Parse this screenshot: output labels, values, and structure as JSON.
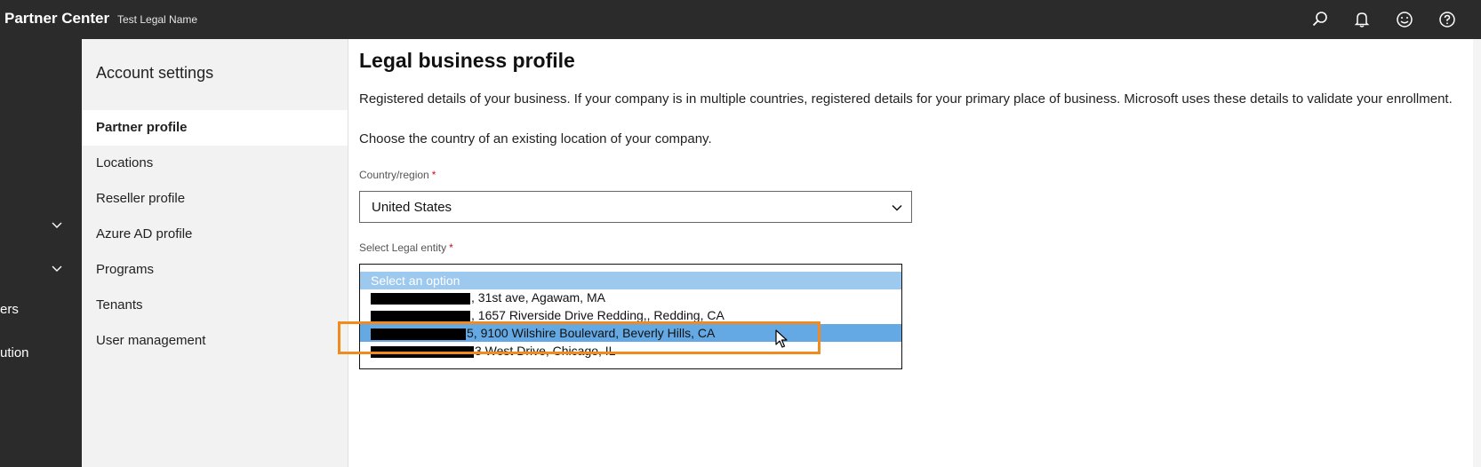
{
  "topbar": {
    "app_title": "Partner Center",
    "tenant_name": "Test Legal Name",
    "icons": [
      "search-icon",
      "notification-bell-icon",
      "feedback-smiley-icon",
      "help-icon"
    ]
  },
  "left_nav": {
    "items_visible_text": [
      "ers",
      "ution"
    ],
    "chevrons": [
      "chevron-down-icon",
      "chevron-down-icon"
    ]
  },
  "settings": {
    "title": "Account settings",
    "items": [
      {
        "label": "Partner profile",
        "active": true
      },
      {
        "label": "Locations"
      },
      {
        "label": "Reseller profile"
      },
      {
        "label": "Azure AD profile"
      },
      {
        "label": "Programs"
      },
      {
        "label": "Tenants"
      },
      {
        "label": "User management"
      }
    ]
  },
  "main": {
    "title": "Legal business profile",
    "description": "Registered details of your business. If your company is in multiple countries, registered details for your primary place of business. Microsoft uses these details to validate your enrollment.",
    "choose_text": "Choose the country of an existing location of your company.",
    "country": {
      "label": "Country/region",
      "required_mark": "*",
      "value": "United States"
    },
    "entity": {
      "label": "Select Legal entity",
      "required_mark": "*",
      "options": [
        {
          "text": "Select an option",
          "state": "placeholder"
        },
        {
          "text": ", 31st ave, Agawam, MA",
          "redacted": true
        },
        {
          "text": ", 1657 Riverside Drive Redding,, Redding, CA",
          "redacted": true
        },
        {
          "text": "5, 9100 Wilshire Boulevard, Beverly Hills, CA",
          "redacted": true,
          "state": "selected"
        },
        {
          "text": "3 West Drive, Chicago, IL",
          "redacted": true
        }
      ]
    }
  },
  "colors": {
    "topbar_bg": "#2b2b2b",
    "settings_bg": "#f2f2f2",
    "placeholder_option_bg": "#9dc9ee",
    "selected_option_bg": "#64a9e4",
    "highlight_border": "#f28a1e",
    "required_mark": "#c50f1f"
  }
}
